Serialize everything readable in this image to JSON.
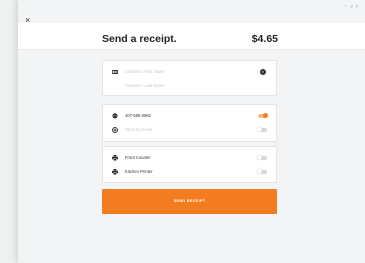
{
  "header": {
    "close_glyph": "×",
    "title": "Send a receipt.",
    "amount": "$4.65"
  },
  "customer": {
    "first_name_placeholder": "Customer First Name",
    "last_name_placeholder": "Customer Last Name",
    "clear_icon": "close-circle-icon"
  },
  "delivery": {
    "phone": {
      "label": "407-555-0982",
      "enabled": true
    },
    "email": {
      "label": "Send by Email",
      "enabled": false
    }
  },
  "printers": [
    {
      "label": "Front Counter",
      "enabled": false
    },
    {
      "label": "Kitchen Printer",
      "enabled": false
    }
  ],
  "actions": {
    "send_label": "SEND RECEIPT"
  },
  "colors": {
    "accent": "#f47c20",
    "background": "#f3f4f5",
    "card": "#ffffff"
  }
}
